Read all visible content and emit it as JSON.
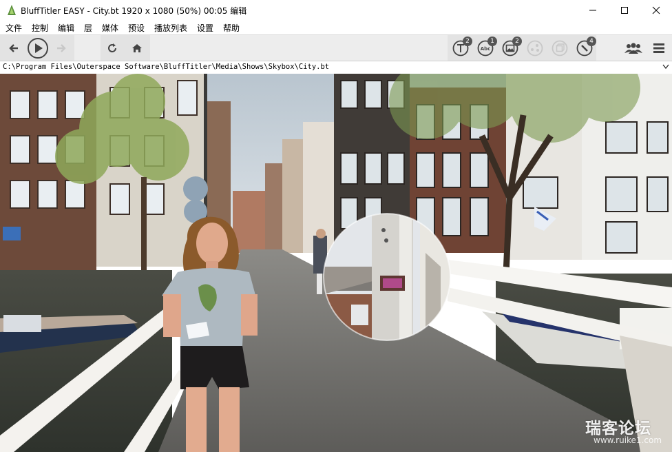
{
  "window": {
    "title": "BluffTitler EASY  - City.bt 1920 x 1080 (50%) 00:05 编辑"
  },
  "menu": [
    "文件",
    "控制",
    "编辑",
    "层",
    "媒体",
    "预设",
    "播放列表",
    "设置",
    "帮助"
  ],
  "toolbar": {
    "badges": {
      "text_layer": "2",
      "abc_layer": "1",
      "picture_layer": "2",
      "connect_layer": "4"
    }
  },
  "path": "C:\\Program Files\\Outerspace Software\\BluffTitler\\Media\\Shows\\Skybox\\City.bt",
  "watermark": {
    "text": "瑞客论坛",
    "url": "www.ruike1.com"
  },
  "colors": {
    "toolbar_bg": "#ededed",
    "badge": "#555555",
    "icon": "#444444"
  }
}
